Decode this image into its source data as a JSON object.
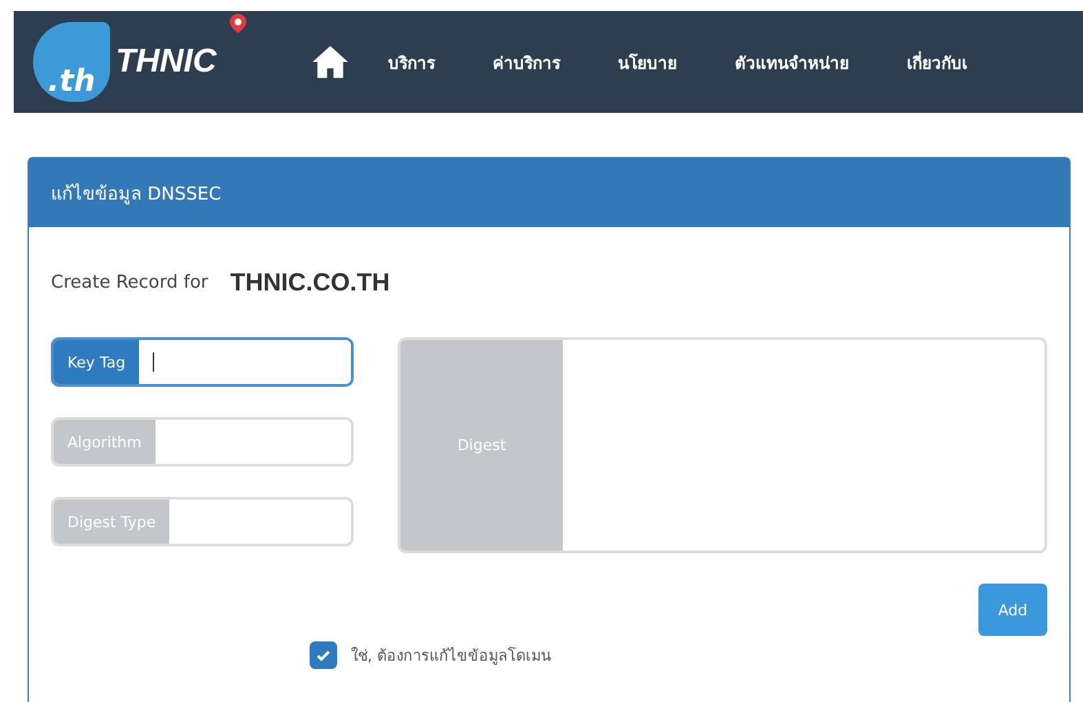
{
  "logo": {
    "badge": ".th",
    "wordmark": "THNIC"
  },
  "nav": [
    {
      "label": "บริการ"
    },
    {
      "label": "ค่าบริการ"
    },
    {
      "label": "นโยบาย"
    },
    {
      "label": "ตัวแทนจำหน่าย"
    },
    {
      "label": "เกี่ยวกับเ"
    }
  ],
  "panel": {
    "title": "แก้ไขข้อมูล DNSSEC",
    "record_label": "Create Record for",
    "domain": "THNIC.CO.TH",
    "fields": [
      {
        "label": "Key Tag",
        "selected": true
      },
      {
        "label": "Algorithm",
        "selected": false
      },
      {
        "label": "Digest Type",
        "selected": false
      }
    ],
    "digest": {
      "label": "Digest"
    },
    "add_button": "Add",
    "confirm": {
      "label": "ใช่, ต้องการแก้ไขข้อมูลโดเมน",
      "checked": true
    }
  }
}
